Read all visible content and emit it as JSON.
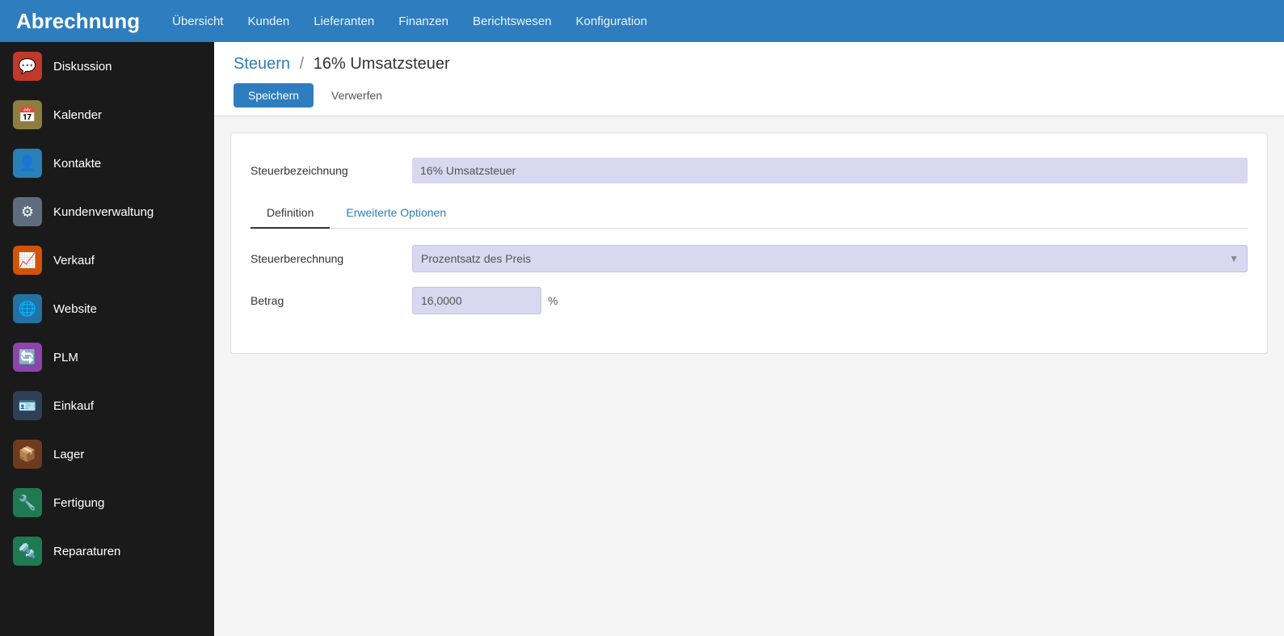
{
  "app": {
    "title": "Abrechnung"
  },
  "top_nav": {
    "items": [
      {
        "label": "Übersicht",
        "id": "ubersicht"
      },
      {
        "label": "Kunden",
        "id": "kunden"
      },
      {
        "label": "Lieferanten",
        "id": "lieferanten"
      },
      {
        "label": "Finanzen",
        "id": "finanzen"
      },
      {
        "label": "Berichtswesen",
        "id": "berichtswesen"
      },
      {
        "label": "Konfiguration",
        "id": "konfiguration"
      }
    ]
  },
  "sidebar": {
    "items": [
      {
        "label": "Diskussion",
        "icon": "💬",
        "color": "#c0392b",
        "id": "diskussion"
      },
      {
        "label": "Kalender",
        "icon": "📅",
        "color": "#8e7d3f",
        "id": "kalender"
      },
      {
        "label": "Kontakte",
        "icon": "👤",
        "color": "#2980b9",
        "id": "kontakte"
      },
      {
        "label": "Kundenverwaltung",
        "icon": "⚙",
        "color": "#5d6d7e",
        "id": "kundenverwaltung"
      },
      {
        "label": "Verkauf",
        "icon": "📈",
        "color": "#d35400",
        "id": "verkauf"
      },
      {
        "label": "Website",
        "icon": "🌐",
        "color": "#2471a3",
        "id": "website"
      },
      {
        "label": "PLM",
        "icon": "🔄",
        "color": "#8e44ad",
        "id": "plm"
      },
      {
        "label": "Einkauf",
        "icon": "🪪",
        "color": "#2e4057",
        "id": "einkauf"
      },
      {
        "label": "Lager",
        "icon": "📦",
        "color": "#6e3b1e",
        "id": "lager"
      },
      {
        "label": "Fertigung",
        "icon": "🔧",
        "color": "#1e7a50",
        "id": "fertigung"
      },
      {
        "label": "Reparaturen",
        "icon": "🔩",
        "color": "#1e7a50",
        "id": "reparaturen"
      }
    ]
  },
  "breadcrumb": {
    "parent": "Steuern",
    "separator": "/",
    "current": "16% Umsatzsteuer"
  },
  "toolbar": {
    "save_label": "Speichern",
    "discard_label": "Verwerfen"
  },
  "form": {
    "steuerbezeichnung_label": "Steuerbezeichnung",
    "steuerbezeichnung_value": "16% Umsatzsteuer",
    "tabs": [
      {
        "label": "Definition",
        "active": true,
        "id": "definition"
      },
      {
        "label": "Erweiterte Optionen",
        "active": false,
        "id": "erweiterte-optionen"
      }
    ],
    "steuerberechnung_label": "Steuerberechnung",
    "steuerberechnung_value": "Prozentsatz des Preis",
    "betrag_label": "Betrag",
    "betrag_value": "16,0000",
    "betrag_unit": "%"
  },
  "sidebar_icon_colors": {
    "diskussion": "#c0392b",
    "kalender": "#8e7d3f",
    "kontakte": "#2980b9",
    "kundenverwaltung": "#5d6d7e",
    "verkauf": "#d35400",
    "website": "#2471a3",
    "plm": "#8e44ad",
    "einkauf": "#2e4057",
    "lager": "#6e3b1e",
    "fertigung": "#1e7a50",
    "reparaturen": "#1e7a50"
  }
}
